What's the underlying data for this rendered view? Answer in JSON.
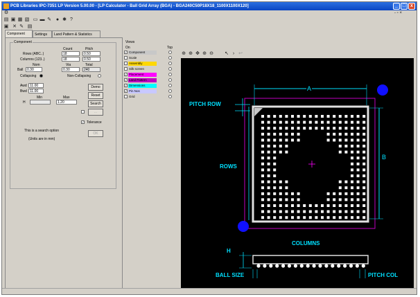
{
  "window": {
    "title": "PCB Libraries IPC-7351 LP Version 5.00.00 - [LP Calculator - Ball Grid Array (BGA) - BGA240C50P18X18_1100X1100X120]",
    "min_glyph": "_",
    "max_glyph": "□",
    "close_glyph": "x",
    "mdi_controls": "- ▫ ×"
  },
  "tabs": [
    {
      "label": "Component",
      "active": true
    },
    {
      "label": "Settings",
      "active": false
    },
    {
      "label": "Land Pattern & Statistics",
      "active": false
    }
  ],
  "component": {
    "group_title": "Component",
    "headers": {
      "count": "Count",
      "pitch": "Pitch"
    },
    "rows_label": "Rows (ABC..)",
    "rows_count": "18",
    "rows_pitch": "0.50",
    "cols_label": "Columns (123..)",
    "cols_count": "18",
    "cols_pitch": "0.50",
    "ball_headers": {
      "nom": "Nom",
      "via": "Via",
      "total": "Total"
    },
    "ball_label": "Ball",
    "ball_nom": "0.30",
    "ball_via": "0.30",
    "ball_total": "240",
    "collapsing_label": "Collapsing",
    "noncollapsing_label": "Non-Collapsing",
    "a_label": "Awd",
    "a_value": "11.00",
    "b_label": "Bwd",
    "b_value": "11.00",
    "min_label": "Min",
    "max_label": "Max",
    "h_label": "H",
    "h_min": "",
    "h_max": "1.20",
    "btn_demo": "Demo",
    "btn_reset": "Reset",
    "btn_search": "Search",
    "btn_disabled": "...",
    "tolerance_label": "Tolerance",
    "search_hint": "This is a search option",
    "units_hint": "(Units are in mm)",
    "btn_ok": "OK"
  },
  "views": {
    "title": "Views",
    "col_on": "On",
    "col_top": "Top",
    "items": [
      {
        "label": "Component",
        "checked": true,
        "color": "#c8c8c8"
      },
      {
        "label": "Scale",
        "checked": false,
        "color": ""
      },
      {
        "label": "Assembly",
        "checked": false,
        "color": "#ffd800"
      },
      {
        "label": "Silk screen",
        "checked": false,
        "color": ""
      },
      {
        "label": "Placement",
        "checked": true,
        "color": "#ff00ff"
      },
      {
        "label": "Land Pattern",
        "checked": true,
        "color": "#c000c0"
      },
      {
        "label": "Dimensions",
        "checked": true,
        "color": "#00ffff"
      },
      {
        "label": "Pin Nos",
        "checked": true,
        "color": "#c8c8ff"
      },
      {
        "label": "Grid",
        "checked": false,
        "color": ""
      }
    ]
  },
  "drawing": {
    "label_a": "A",
    "label_b": "B",
    "pitch_row": "PITCH ROW",
    "rows": "ROWS",
    "columns": "COLUMNS",
    "h": "H",
    "ball_size": "BALL SIZE",
    "pitch_col": "PITCH COL",
    "accent": "#00e0ff",
    "outline": "#c000c0",
    "dot": "#1010ff"
  }
}
